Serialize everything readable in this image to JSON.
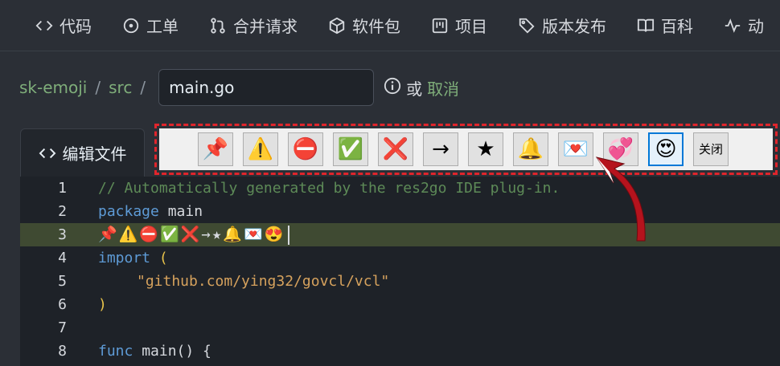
{
  "nav": {
    "items": [
      {
        "icon": "code-icon",
        "label": "代码"
      },
      {
        "icon": "issue-icon",
        "label": "工单"
      },
      {
        "icon": "pull-request-icon",
        "label": "合并请求"
      },
      {
        "icon": "package-icon",
        "label": "软件包"
      },
      {
        "icon": "project-icon",
        "label": "项目"
      },
      {
        "icon": "tag-icon",
        "label": "版本发布"
      },
      {
        "icon": "book-icon",
        "label": "百科"
      },
      {
        "icon": "activity-icon",
        "label": "动"
      }
    ]
  },
  "breadcrumb": {
    "repo": "sk-emoji",
    "sep1": "/",
    "dir": "src",
    "sep2": "/",
    "filename": "main.go",
    "or": "或",
    "cancel": "取消"
  },
  "tab": {
    "label": "编辑文件"
  },
  "emoji_toolbar": {
    "buttons": [
      "📌",
      "⚠️",
      "⛔",
      "✅",
      "❌",
      "→",
      "★",
      "🔔",
      "💌",
      "💞",
      "😍"
    ],
    "close_label": "关闭"
  },
  "editor": {
    "lines": [
      {
        "n": "1",
        "text": "// Automatically generated by the res2go IDE plug-in."
      },
      {
        "n": "2",
        "kw": "package",
        "rest": " main"
      },
      {
        "n": "3",
        "emoji": [
          "📌",
          "⚠️",
          "⛔",
          "✅",
          "❌",
          "→",
          "★",
          "🔔",
          "💌",
          "😍"
        ]
      },
      {
        "n": "4",
        "kw": "import",
        "rest": " ("
      },
      {
        "n": "5",
        "str": "\"github.com/ying32/govcl/vcl\""
      },
      {
        "n": "6",
        "br": ")"
      },
      {
        "n": "7"
      },
      {
        "n": "8",
        "kw": "func",
        "rest": " main() {"
      }
    ]
  }
}
